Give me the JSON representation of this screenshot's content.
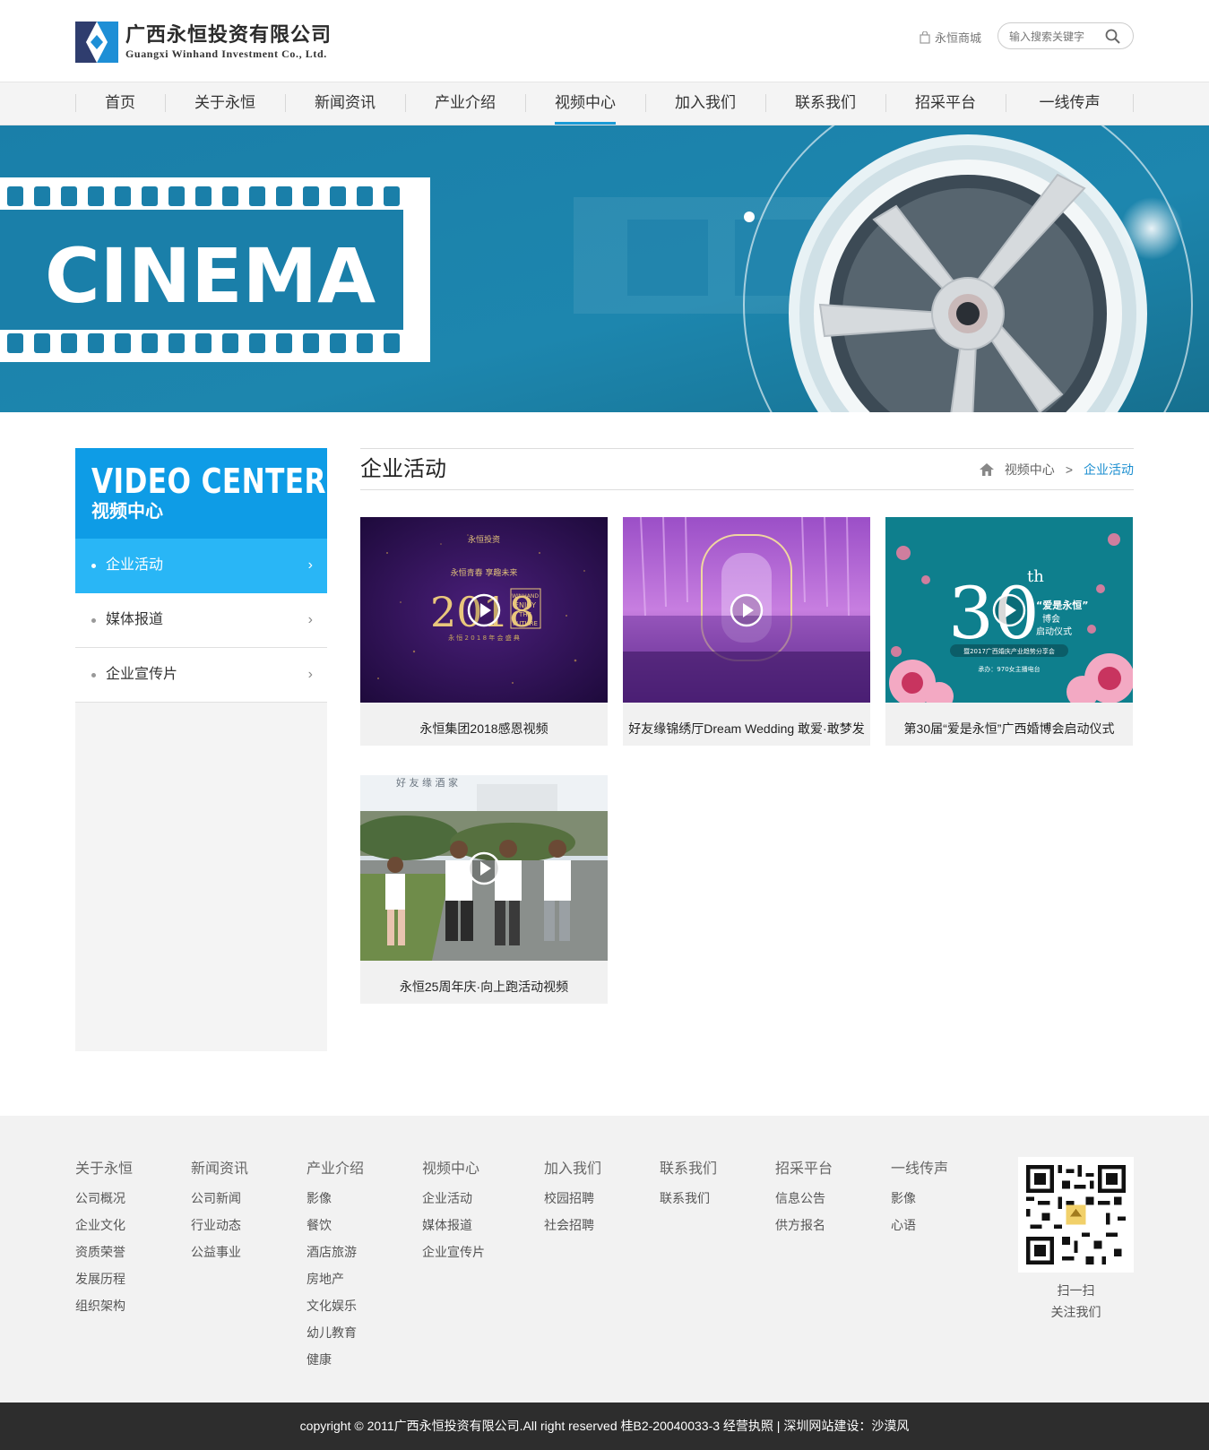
{
  "header": {
    "logo_cn": "广西永恒投资有限公司",
    "logo_en": "Guangxi Winhand Investment Co., Ltd.",
    "shop_link": "永恒商城",
    "search_placeholder": "输入搜索关键字"
  },
  "nav": {
    "items": [
      {
        "label": "首页"
      },
      {
        "label": "关于永恒"
      },
      {
        "label": "新闻资讯"
      },
      {
        "label": "产业介绍"
      },
      {
        "label": "视频中心"
      },
      {
        "label": "加入我们"
      },
      {
        "label": "联系我们"
      },
      {
        "label": "招采平台"
      },
      {
        "label": "一线传声"
      }
    ],
    "active_index": 4
  },
  "banner": {
    "text": "CINEMA"
  },
  "sidebar": {
    "title_en": "VIDEO CENTER",
    "title_cn": "视频中心",
    "items": [
      {
        "label": "企业活动",
        "arrow": "›"
      },
      {
        "label": "媒体报道",
        "arrow": "›"
      },
      {
        "label": "企业宣传片",
        "arrow": "›"
      }
    ]
  },
  "content": {
    "title": "企业活动",
    "breadcrumb": {
      "parent": "视频中心",
      "separator": ">",
      "current": "企业活动"
    },
    "videos": [
      {
        "caption": "永恒集团2018感恩视频",
        "thumb_text": {
          "brand": "永恒投资",
          "slogan": "永恒青春 享趣未来",
          "year": "2018",
          "enjoy": [
            "WINHAND",
            "ENJOY",
            "THE",
            "FUTURE"
          ],
          "event": "永 恒 2 0 1 8 年 会 盛 典"
        }
      },
      {
        "caption": "好友缘锦绣厅Dream Wedding 敢爱·敢梦发",
        "thumb_text": {}
      },
      {
        "caption": "第30届“爱是永恒”广西婚博会启动仪式",
        "thumb_text": {
          "number": "30",
          "suffix": "th",
          "theme": "“爱是永恒”",
          "sub1": "博会",
          "sub2": "启动仪式",
          "banner": "暨2017广西婚庆产业趋势分享会",
          "footer": "承办：970女主播电台"
        }
      },
      {
        "caption": "永恒25周年庆·向上跑活动视频",
        "thumb_text": {
          "sign": "好 友 缘 酒 家"
        }
      }
    ]
  },
  "footer": {
    "columns": [
      {
        "heading": "关于永恒",
        "links": [
          "公司概况",
          "企业文化",
          "资质荣誉",
          "发展历程",
          "组织架构"
        ]
      },
      {
        "heading": "新闻资讯",
        "links": [
          "公司新闻",
          "行业动态",
          "公益事业"
        ]
      },
      {
        "heading": "产业介绍",
        "links": [
          "影像",
          "餐饮",
          "酒店旅游",
          "房地产",
          "文化娱乐",
          "幼儿教育",
          "健康"
        ]
      },
      {
        "heading": "视频中心",
        "links": [
          "企业活动",
          "媒体报道",
          "企业宣传片"
        ]
      },
      {
        "heading": "加入我们",
        "links": [
          "校园招聘",
          "社会招聘"
        ]
      },
      {
        "heading": "联系我们",
        "links": [
          "联系我们"
        ]
      },
      {
        "heading": "招采平台",
        "links": [
          "信息公告",
          "供方报名"
        ]
      },
      {
        "heading": "一线传声",
        "links": [
          "影像",
          "心语"
        ]
      }
    ],
    "qr_line1": "扫一扫",
    "qr_line2": "关注我们"
  },
  "copyright": "copyright © 2011广西永恒投资有限公司.All right reserved 桂B2-20040033-3 经营执照 | 深圳网站建设：沙漠风",
  "colors": {
    "accent": "#1a9bd7",
    "sidebar_header": "#0e9ce6",
    "sidebar_active": "#29b6f6",
    "banner": "#1c7fa8",
    "footer_bg": "#f2f2f2",
    "copyright_bg": "#2d2d2d"
  }
}
